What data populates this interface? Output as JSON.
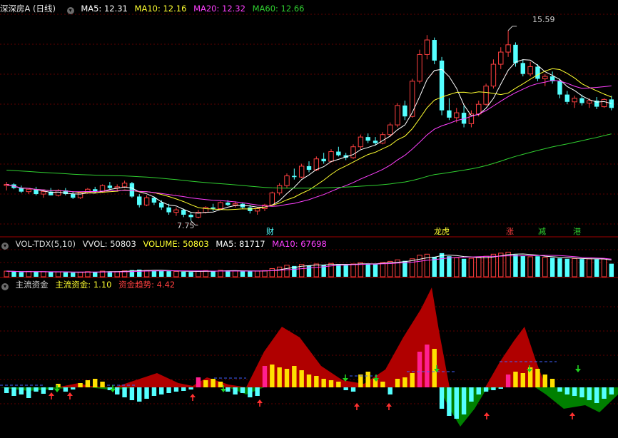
{
  "price_header": {
    "stock_name": "深深房A (日线)",
    "ma5": "MA5: 12.31",
    "ma10": "MA10: 12.16",
    "ma20": "MA20: 12.32",
    "ma60": "MA60: 12.66"
  },
  "price_annotations": {
    "high_label": "15.59",
    "low_label": "7.75",
    "event_cai": "财",
    "event_longhu": "龙虎",
    "event_zhang": "涨",
    "event_jian": "减",
    "event_gang": "港"
  },
  "volume_header": {
    "name": "VOL-TDX(5,10)",
    "vvol": "VVOL: 50803",
    "volume": "VOLUME: 50803",
    "ma5": "MA5: 81717",
    "ma10": "MA10: 67698"
  },
  "fund_header": {
    "name": "主流资金",
    "main_fund": "主流资金: 1.10",
    "fund_trend": "资金趋势: 4.42"
  },
  "colors": {
    "up": "#ff4040",
    "down": "#54ffff",
    "ma5": "#ffffff",
    "ma10": "#ffff30",
    "ma20": "#ff40ff",
    "ma60": "#30d030",
    "trend_red": "#b00000",
    "trend_green": "#008000",
    "bar_yellow": "#ffe000",
    "bar_magenta": "#ff2090",
    "grid": "#800000"
  },
  "chart_data": [
    {
      "type": "candlestick",
      "title": "深深房A (日线)",
      "ylim": [
        7.5,
        16.2
      ],
      "high": 15.59,
      "low": 7.75,
      "candles_ohlc": [
        [
          9.2,
          9.35,
          9.0,
          9.25
        ],
        [
          9.25,
          9.3,
          9.05,
          9.1
        ],
        [
          9.1,
          9.2,
          8.9,
          8.95
        ],
        [
          8.95,
          9.1,
          8.85,
          9.05
        ],
        [
          9.05,
          9.15,
          8.8,
          8.85
        ],
        [
          8.85,
          9.0,
          8.7,
          8.95
        ],
        [
          8.95,
          9.1,
          8.8,
          8.8
        ],
        [
          8.8,
          9.05,
          8.75,
          9.0
        ],
        [
          9.0,
          9.1,
          8.8,
          8.85
        ],
        [
          8.85,
          8.95,
          8.65,
          8.7
        ],
        [
          8.7,
          8.95,
          8.65,
          8.9
        ],
        [
          8.9,
          9.1,
          8.85,
          9.05
        ],
        [
          9.05,
          9.15,
          8.9,
          8.95
        ],
        [
          8.95,
          9.25,
          8.9,
          9.2
        ],
        [
          9.2,
          9.35,
          9.05,
          9.1
        ],
        [
          9.1,
          9.25,
          8.95,
          9.15
        ],
        [
          9.15,
          9.4,
          9.1,
          9.3
        ],
        [
          9.3,
          9.35,
          8.7,
          8.75
        ],
        [
          8.75,
          8.85,
          8.3,
          8.4
        ],
        [
          8.4,
          8.8,
          8.35,
          8.7
        ],
        [
          8.7,
          8.75,
          8.4,
          8.5
        ],
        [
          8.5,
          8.6,
          8.2,
          8.3
        ],
        [
          8.3,
          8.45,
          8.0,
          8.1
        ],
        [
          8.1,
          8.3,
          7.95,
          8.2
        ],
        [
          8.2,
          8.25,
          7.9,
          8.0
        ],
        [
          8.0,
          8.1,
          7.75,
          7.9
        ],
        [
          7.9,
          8.2,
          7.85,
          8.1
        ],
        [
          8.1,
          8.35,
          8.05,
          8.3
        ],
        [
          8.3,
          8.45,
          8.15,
          8.25
        ],
        [
          8.25,
          8.55,
          8.2,
          8.5
        ],
        [
          8.5,
          8.6,
          8.35,
          8.4
        ],
        [
          8.4,
          8.55,
          8.3,
          8.45
        ],
        [
          8.45,
          8.5,
          8.25,
          8.3
        ],
        [
          8.3,
          8.4,
          8.05,
          8.15
        ],
        [
          8.15,
          8.3,
          8.0,
          8.25
        ],
        [
          8.25,
          8.45,
          8.15,
          8.4
        ],
        [
          8.4,
          8.95,
          8.35,
          8.9
        ],
        [
          8.9,
          9.3,
          8.8,
          9.2
        ],
        [
          9.2,
          9.7,
          9.1,
          9.6
        ],
        [
          9.6,
          9.9,
          9.45,
          9.55
        ],
        [
          9.55,
          10.1,
          9.5,
          10.0
        ],
        [
          10.0,
          10.2,
          9.75,
          9.85
        ],
        [
          9.85,
          10.4,
          9.8,
          10.3
        ],
        [
          10.3,
          10.55,
          10.1,
          10.2
        ],
        [
          10.2,
          10.7,
          10.15,
          10.6
        ],
        [
          10.6,
          10.8,
          10.4,
          10.45
        ],
        [
          10.45,
          10.55,
          10.25,
          10.35
        ],
        [
          10.35,
          10.9,
          10.3,
          10.8
        ],
        [
          10.8,
          11.3,
          10.7,
          11.2
        ],
        [
          11.2,
          11.35,
          10.95,
          11.05
        ],
        [
          11.05,
          11.2,
          10.85,
          10.95
        ],
        [
          10.95,
          11.4,
          10.9,
          11.3
        ],
        [
          11.3,
          11.8,
          11.2,
          11.7
        ],
        [
          11.7,
          12.6,
          11.6,
          12.5
        ],
        [
          12.5,
          12.7,
          11.9,
          12.05
        ],
        [
          12.05,
          13.6,
          12.0,
          13.5
        ],
        [
          13.5,
          14.8,
          13.4,
          14.6
        ],
        [
          14.6,
          15.4,
          14.4,
          15.2
        ],
        [
          15.2,
          15.3,
          14.2,
          14.35
        ],
        [
          14.35,
          14.5,
          12.1,
          12.3
        ],
        [
          12.3,
          12.8,
          11.9,
          12.0
        ],
        [
          12.0,
          12.4,
          11.8,
          12.2
        ],
        [
          12.2,
          12.5,
          11.6,
          11.75
        ],
        [
          11.75,
          12.3,
          11.6,
          12.15
        ],
        [
          12.15,
          12.7,
          12.05,
          12.55
        ],
        [
          12.55,
          13.4,
          12.5,
          13.3
        ],
        [
          13.3,
          14.4,
          13.2,
          14.2
        ],
        [
          14.2,
          14.9,
          14.0,
          14.7
        ],
        [
          14.7,
          15.59,
          14.5,
          15.0
        ],
        [
          15.0,
          15.1,
          14.1,
          14.25
        ],
        [
          14.25,
          14.4,
          13.7,
          13.8
        ],
        [
          13.8,
          14.3,
          13.7,
          14.1
        ],
        [
          14.1,
          14.2,
          13.5,
          13.6
        ],
        [
          13.6,
          13.8,
          13.3,
          13.7
        ],
        [
          13.7,
          13.9,
          13.4,
          13.5
        ],
        [
          13.5,
          13.6,
          12.8,
          12.95
        ],
        [
          12.95,
          13.1,
          12.55,
          12.65
        ],
        [
          12.65,
          12.9,
          12.4,
          12.8
        ],
        [
          12.8,
          12.95,
          12.5,
          12.6
        ],
        [
          12.6,
          12.8,
          12.4,
          12.7
        ],
        [
          12.7,
          12.85,
          12.35,
          12.45
        ],
        [
          12.45,
          12.8,
          12.4,
          12.75
        ],
        [
          12.75,
          12.9,
          12.3,
          12.4
        ]
      ]
    },
    {
      "type": "bar",
      "title": "VOL-TDX(5,10)",
      "series": [
        {
          "name": "VOLUME",
          "values": [
            22,
            20,
            18,
            21,
            19,
            20,
            18,
            19,
            17,
            16,
            18,
            20,
            19,
            22,
            21,
            20,
            23,
            26,
            28,
            25,
            24,
            23,
            22,
            21,
            20,
            19,
            22,
            24,
            23,
            25,
            24,
            23,
            22,
            21,
            22,
            24,
            32,
            38,
            45,
            42,
            48,
            44,
            50,
            46,
            52,
            49,
            45,
            50,
            55,
            52,
            50,
            56,
            60,
            66,
            62,
            70,
            84,
            88,
            78,
            92,
            80,
            74,
            70,
            72,
            76,
            80,
            88,
            92,
            96,
            86,
            82,
            78,
            80,
            76,
            74,
            72,
            70,
            71,
            69,
            70,
            68,
            69,
            51
          ]
        }
      ],
      "vvol": 50803,
      "ma5": 81717,
      "ma10": 67698
    },
    {
      "type": "area",
      "title": "主流资金",
      "main_fund": 1.1,
      "fund_trend": 4.42
    }
  ]
}
